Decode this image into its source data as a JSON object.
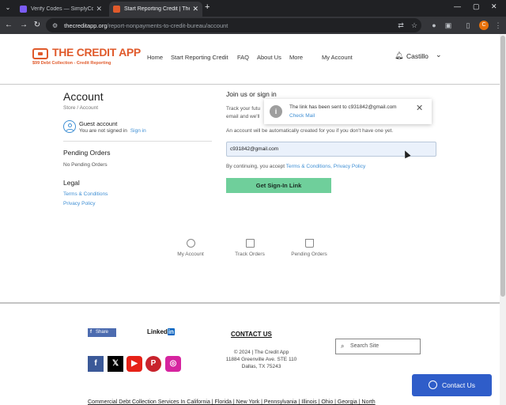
{
  "browser": {
    "tabs": [
      {
        "title": "Verify Codes — SimplyCodes",
        "favicon_color": "#7b5cf5"
      },
      {
        "title": "Start Reporting Credit | The Cre",
        "favicon_color": "#e05a2b"
      }
    ],
    "url_host": "thecreditapp.org",
    "url_path": "/report-nonpayments-to-credit-bureau/account",
    "profile_initial": "C"
  },
  "site": {
    "logo_text": "THE CREDIT APP",
    "logo_sub": "$99 Debt Collection - Credit Reporting",
    "nav": [
      "Home",
      "Start Reporting Credit",
      "FAQ",
      "About Us",
      "More",
      "My Account"
    ],
    "user_name": "Castillo"
  },
  "account": {
    "title": "Account",
    "breadcrumb": "Store  /  Account",
    "guest_title": "Guest account",
    "guest_desc": "You are not signed in",
    "sign_in_link": "Sign in",
    "pending_title": "Pending Orders",
    "pending_text": "No Pending Orders",
    "legal_title": "Legal",
    "legal_links": [
      "Terms & Conditions",
      "Privacy Policy"
    ]
  },
  "signin": {
    "title": "Join us or sign in",
    "track_text_1": "Track your futu",
    "track_text_2": "email and we'll",
    "auto_text": "An account will be automatically created for you if you don't have one yet.",
    "email_value": "c931842@gmail.com",
    "consent_prefix": "By continuing, you accept",
    "terms_link": "Terms & Conditions,",
    "privacy_link": "Privacy Policy",
    "button_label": "Get Sign-In Link"
  },
  "toast": {
    "message": "The link has been sent to c931842@gmail.com",
    "link": "Check Mail"
  },
  "bottom_nav": [
    "My Account",
    "Track Orders",
    "Pending Orders"
  ],
  "footer": {
    "share_label": "Share",
    "linkedin_prefix": "Linked",
    "linkedin_suffix": "in",
    "contact_title": "CONTACT US",
    "copyright": "© 2024 | The Credit App",
    "address_1": "11884 Greenville Ave. STE 110",
    "address_2": "Dallas, TX 75243",
    "search_placeholder": "Search Site",
    "chat_label": "Contact Us",
    "states_links": "Commercial Debt Collection Services In California | Florida | New York | Pennsylvania | Illinois | Ohio | Georgia | North"
  },
  "colors": {
    "brand_orange": "#e05a2b",
    "link_blue": "#3f8fd4",
    "button_green": "#6fcf9b",
    "chat_blue": "#2f5dc9"
  }
}
